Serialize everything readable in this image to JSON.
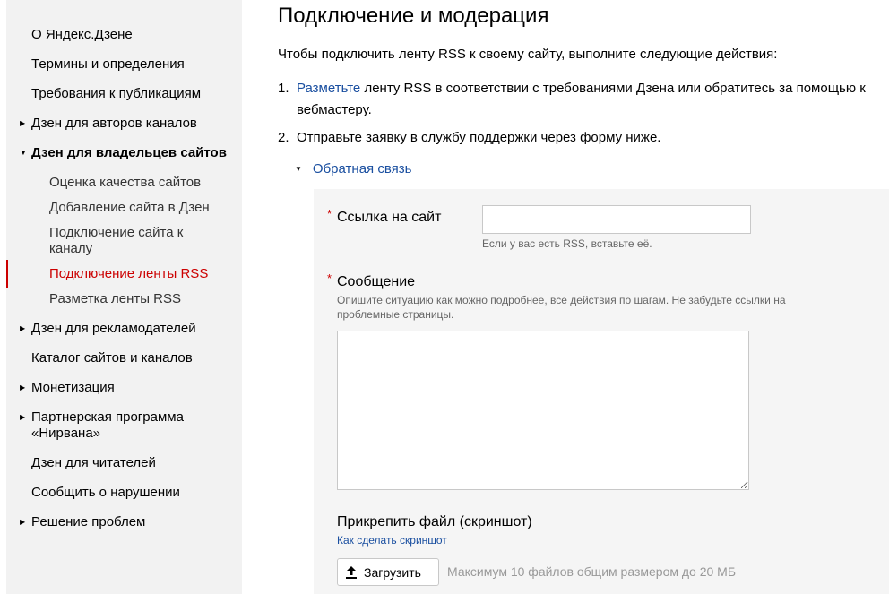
{
  "sidebar": {
    "items": [
      {
        "label": "О Яндекс.Дзене"
      },
      {
        "label": "Термины и определения"
      },
      {
        "label": "Требования к публикациям"
      },
      {
        "label": "Дзен для авторов каналов"
      },
      {
        "label": "Дзен для владельцев сайтов"
      },
      {
        "label": "Дзен для рекламодателей"
      },
      {
        "label": "Каталог сайтов и каналов"
      },
      {
        "label": "Монетизация"
      },
      {
        "label": "Партнерская программа «Нирвана»"
      },
      {
        "label": "Дзен для читателей"
      },
      {
        "label": "Сообщить о нарушении"
      },
      {
        "label": "Решение проблем"
      }
    ],
    "sub_items": [
      {
        "label": "Оценка качества сайтов"
      },
      {
        "label": "Добавление сайта в Дзен"
      },
      {
        "label": "Подключение сайта к каналу"
      },
      {
        "label": "Подключение ленты RSS"
      },
      {
        "label": "Разметка ленты RSS"
      }
    ],
    "active_color": "#cc0000"
  },
  "main": {
    "title": "Подключение и модерация",
    "intro": "Чтобы подключить ленту RSS к своему сайту, выполните следующие действия:",
    "steps": [
      {
        "num": "1.",
        "link": "Разметьте",
        "text": " ленту RSS в соответствии с требованиями Дзена или обратитесь за помощью к вебмастеру."
      },
      {
        "num": "2.",
        "text": "Отправьте заявку в службу поддержки через форму ниже."
      }
    ],
    "feedback_toggle": "Обратная связь"
  },
  "form": {
    "required_mark": "*",
    "site_link_label": "Ссылка на сайт",
    "site_link_value": "",
    "site_link_hint": "Если у вас есть RSS, вставьте её.",
    "message_label": "Сообщение",
    "message_hint": "Опишите ситуацию как можно подробнее, все действия по шагам. Не забудьте ссылки на проблемные страницы.",
    "message_value": "",
    "attach_label": "Прикрепить файл (скриншот)",
    "screenshot_help": "Как сделать скриншот",
    "upload_button": "Загрузить",
    "upload_note": "Максимум 10 файлов общим размером до 20 МБ"
  },
  "colors": {
    "link": "#1a4fa0",
    "accent": "#cc0000",
    "panel": "#f5f5f5"
  }
}
